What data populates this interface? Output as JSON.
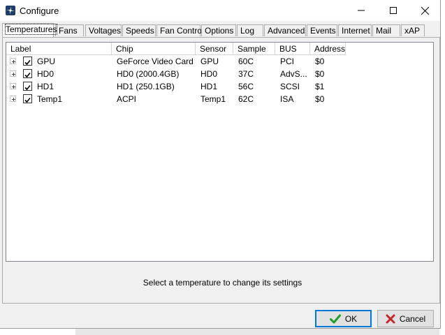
{
  "window": {
    "title": "Configure"
  },
  "tabs": [
    {
      "label": "Temperatures",
      "active": true
    },
    {
      "label": "Fans"
    },
    {
      "label": "Voltages"
    },
    {
      "label": "Speeds"
    },
    {
      "label": "Fan Control"
    },
    {
      "label": "Options"
    },
    {
      "label": "Log"
    },
    {
      "label": "Advanced"
    },
    {
      "label": "Events"
    },
    {
      "label": "Internet"
    },
    {
      "label": "Mail"
    },
    {
      "label": "xAP"
    }
  ],
  "list": {
    "columns": [
      "Label",
      "Chip",
      "Sensor",
      "Sample",
      "BUS",
      "Address"
    ],
    "rows": [
      {
        "checked": true,
        "label": "GPU",
        "chip": "GeForce Video Card",
        "sensor": "GPU",
        "sample": "60C",
        "bus": "PCI",
        "address": "$0"
      },
      {
        "checked": true,
        "label": "HD0",
        "chip": "HD0 (2000.4GB)",
        "sensor": "HD0",
        "sample": "37C",
        "bus": "AdvS...",
        "address": "$0"
      },
      {
        "checked": true,
        "label": "HD1",
        "chip": "HD1 (250.1GB)",
        "sensor": "HD1",
        "sample": "56C",
        "bus": "SCSI",
        "address": "$1"
      },
      {
        "checked": true,
        "label": "Temp1",
        "chip": "ACPI",
        "sensor": "Temp1",
        "sample": "62C",
        "bus": "ISA",
        "address": "$0"
      }
    ]
  },
  "status_text": "Select a temperature to change its settings",
  "buttons": {
    "ok_label": "OK",
    "cancel_label": "Cancel"
  },
  "colors": {
    "ok_check": "#1e9e2a",
    "cancel_x": "#c1272d",
    "focus_border": "#0078d7"
  }
}
